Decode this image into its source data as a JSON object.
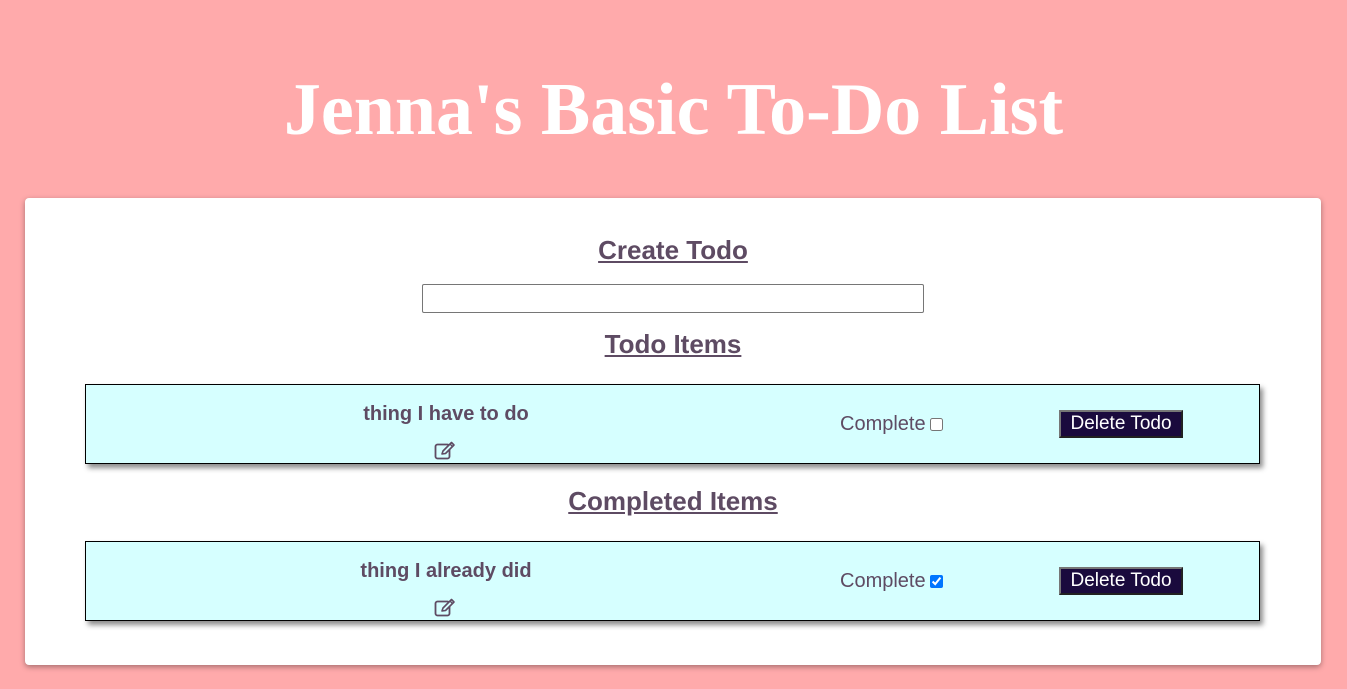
{
  "title": "Jenna's Basic To-Do List",
  "create": {
    "heading": "Create Todo",
    "input_value": "",
    "input_placeholder": ""
  },
  "todo_section": {
    "heading": "Todo Items",
    "items": [
      {
        "text": "thing I have to do",
        "complete_label": "Complete",
        "completed": false,
        "delete_label": "Delete Todo"
      }
    ]
  },
  "completed_section": {
    "heading": "Completed Items",
    "items": [
      {
        "text": "thing I already did",
        "complete_label": "Complete",
        "completed": true,
        "delete_label": "Delete Todo"
      }
    ]
  },
  "icons": {
    "edit": "edit-icon"
  },
  "colors": {
    "background": "#ffaaab",
    "card": "#ffffff",
    "heading": "#5e4b63",
    "todo_card": "#d6ffff",
    "delete_button": "#1a0a3d"
  }
}
